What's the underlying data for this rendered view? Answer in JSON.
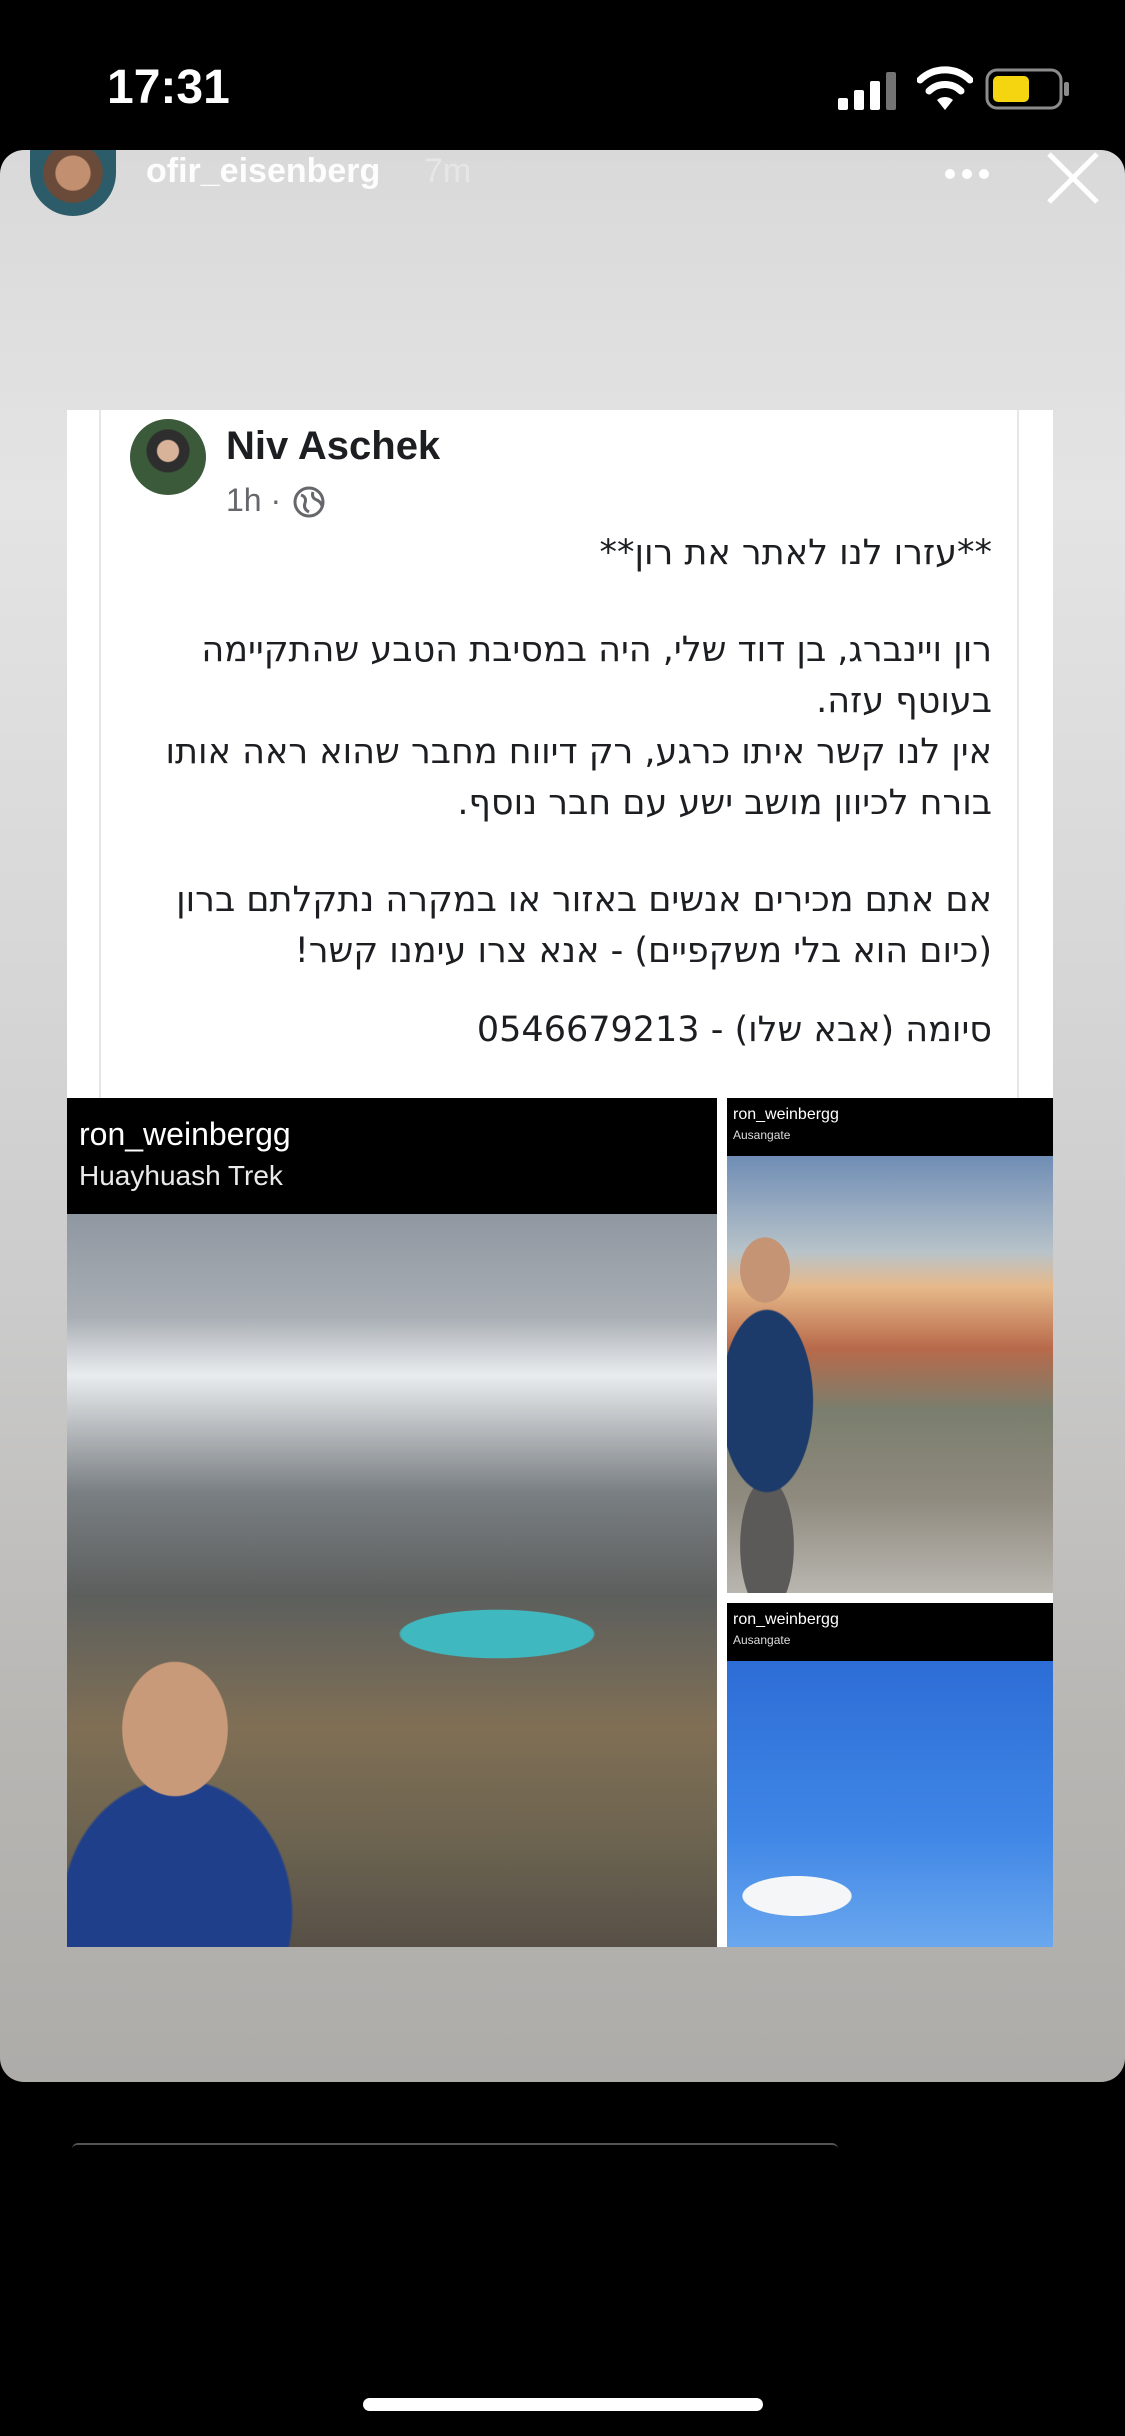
{
  "status_bar": {
    "time": "17:31"
  },
  "story": {
    "username": "ofir_eisenberg",
    "time_ago": "7m"
  },
  "post": {
    "author": "Niv Aschek",
    "time": "1h ·",
    "lines": [
      "**עזרו לנו לאתר את רון**",
      "רון ויינברג, בן דוד שלי, היה במסיבת הטבע שהתקיימה בעוטף עזה.",
      "אין לנו קשר איתו כרגע, רק דיווח מחבר שהוא ראה אותו בורח לכיוון מושב ישע עם חבר נוסף.",
      "אם אתם מכירים אנשים באזור או במקרה נתקלתם ברון (כיום הוא בלי משקפיים) - אנא צרו עימנו קשר!",
      "סיומה (אבא שלו) - 0546679213"
    ]
  },
  "photos": [
    {
      "user": "ron_weinbergg",
      "location": "Huayhuash Trek"
    },
    {
      "user": "ron_weinbergg",
      "location": "Ausangate"
    },
    {
      "user": "ron_weinbergg",
      "location": "Ausangate"
    }
  ],
  "colors": {
    "fb_text": "#1c1e21",
    "fb_meta": "#65676b",
    "battery": "#f5d50f"
  },
  "icons": [
    "signal-icon",
    "wifi-icon",
    "battery-icon",
    "more-icon",
    "close-icon",
    "globe-icon"
  ]
}
